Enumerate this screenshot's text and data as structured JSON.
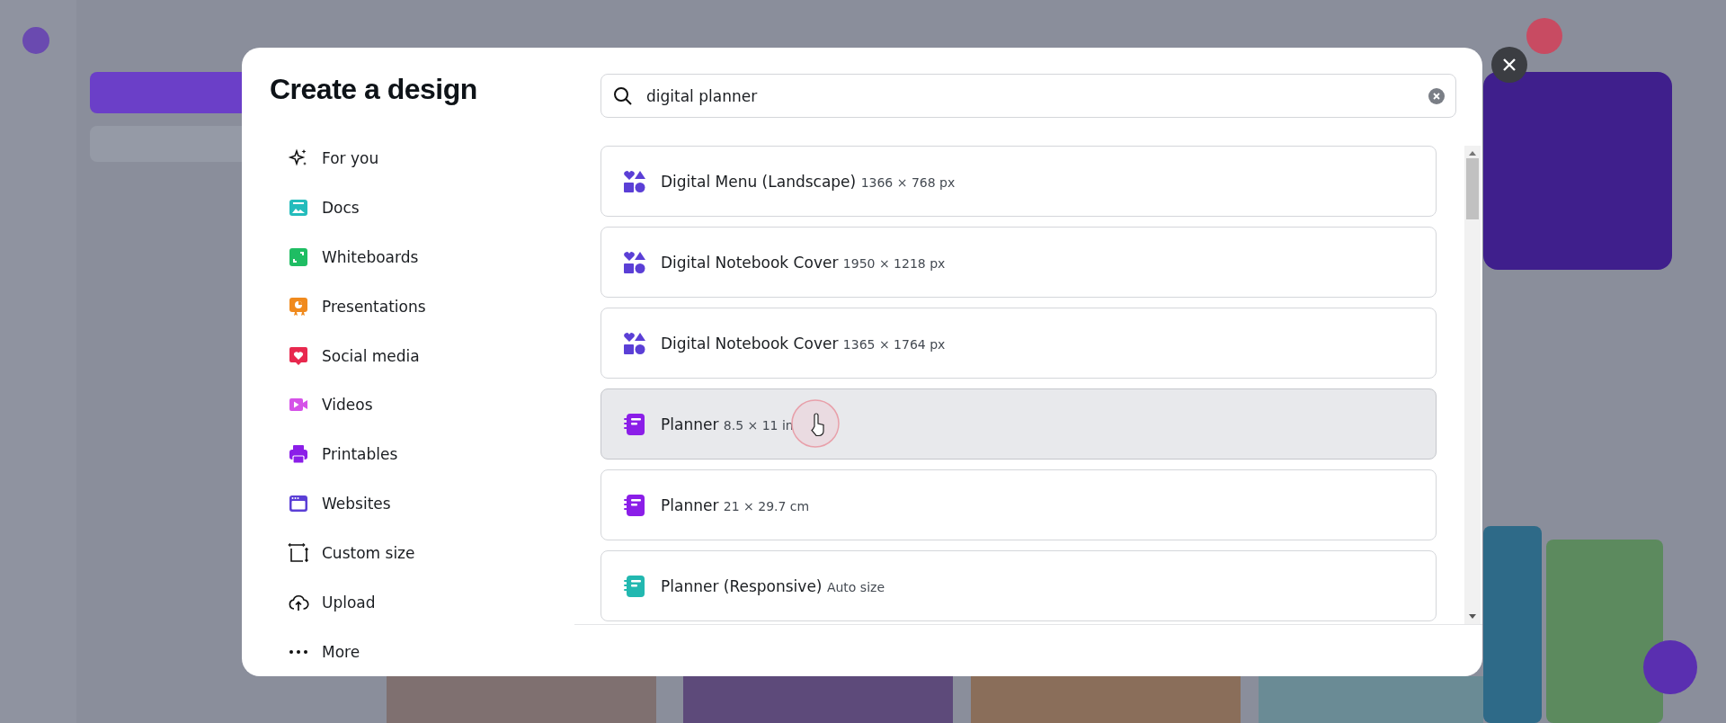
{
  "dialog": {
    "title": "Create a design",
    "categories": [
      {
        "label": "For you",
        "kind": "sparkle"
      },
      {
        "label": "Docs",
        "kind": "doc"
      },
      {
        "label": "Whiteboards",
        "kind": "whiteboard"
      },
      {
        "label": "Presentations",
        "kind": "presentation"
      },
      {
        "label": "Social media",
        "kind": "social"
      },
      {
        "label": "Videos",
        "kind": "video"
      },
      {
        "label": "Printables",
        "kind": "printer"
      },
      {
        "label": "Websites",
        "kind": "website"
      },
      {
        "label": "Custom size",
        "kind": "custom"
      },
      {
        "label": "Upload",
        "kind": "upload"
      },
      {
        "label": "More",
        "kind": "more"
      }
    ],
    "search": {
      "value": "digital planner"
    },
    "results": [
      {
        "name": "Digital Menu (Landscape)",
        "size": "1366 × 768 px",
        "kind": "shapes",
        "color": "#5b3fd6",
        "highlighted": false
      },
      {
        "name": "Digital Notebook Cover",
        "size": "1950 × 1218 px",
        "kind": "shapes",
        "color": "#5b3fd6",
        "highlighted": false
      },
      {
        "name": "Digital Notebook Cover",
        "size": "1365 × 1764 px",
        "kind": "shapes",
        "color": "#5b3fd6",
        "highlighted": false
      },
      {
        "name": "Planner",
        "size": "8.5 × 11 in",
        "kind": "notebook",
        "color": "#8b1ee8",
        "highlighted": true
      },
      {
        "name": "Planner",
        "size": "21 × 29.7 cm",
        "kind": "notebook",
        "color": "#8b1ee8",
        "highlighted": false
      },
      {
        "name": "Planner (Responsive)",
        "size": "Auto size",
        "kind": "notebook",
        "color": "#22b8b0",
        "highlighted": false
      }
    ]
  }
}
